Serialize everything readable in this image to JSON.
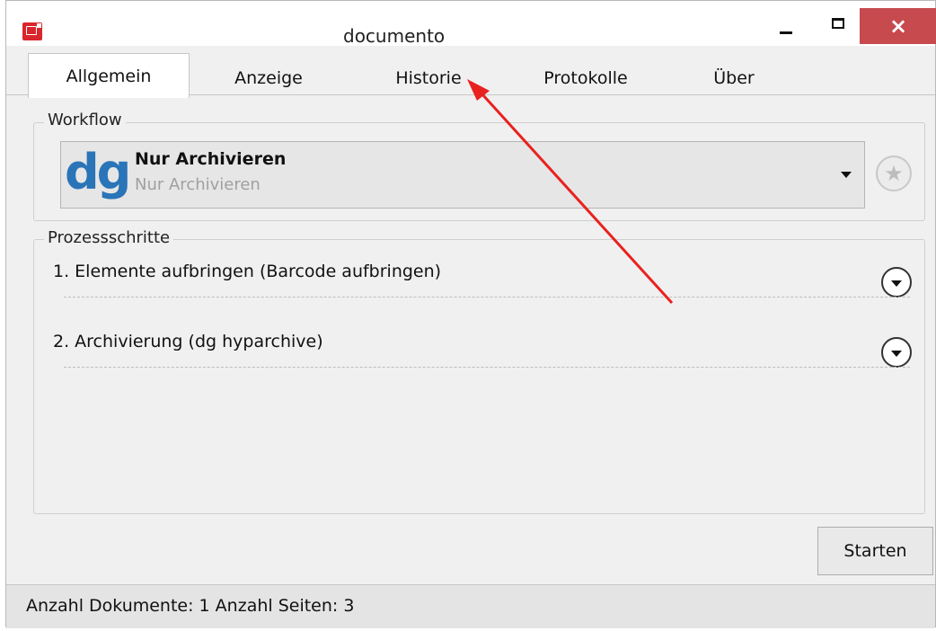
{
  "window": {
    "title": "documento",
    "min_label": "",
    "max_label": "",
    "close_label": "×"
  },
  "tabs": [
    {
      "label": "Allgemein",
      "active": true
    },
    {
      "label": "Anzeige",
      "active": false
    },
    {
      "label": "Historie",
      "active": false
    },
    {
      "label": "Protokolle",
      "active": false
    },
    {
      "label": "Über",
      "active": false
    }
  ],
  "workflow": {
    "group_label": "Workflow",
    "logo_text": "dg",
    "selected_title": "Nur Archivieren",
    "selected_subtitle": "Nur Archivieren",
    "favorite_icon": "star-icon"
  },
  "process_steps": {
    "group_label": "Prozessschritte",
    "steps": [
      {
        "label": "1. Elemente aufbringen (Barcode aufbringen)"
      },
      {
        "label": "2. Archivierung (dg hyparchive)"
      }
    ]
  },
  "actions": {
    "start_label": "Starten"
  },
  "status": {
    "text": "Anzahl Dokumente: 1  Anzahl Seiten: 3"
  },
  "colors": {
    "close_button": "#c74a4f",
    "annotation_arrow": "#e8221f",
    "logo_blue": "#2a74b8",
    "logo_light_blue": "#39a7e0"
  }
}
